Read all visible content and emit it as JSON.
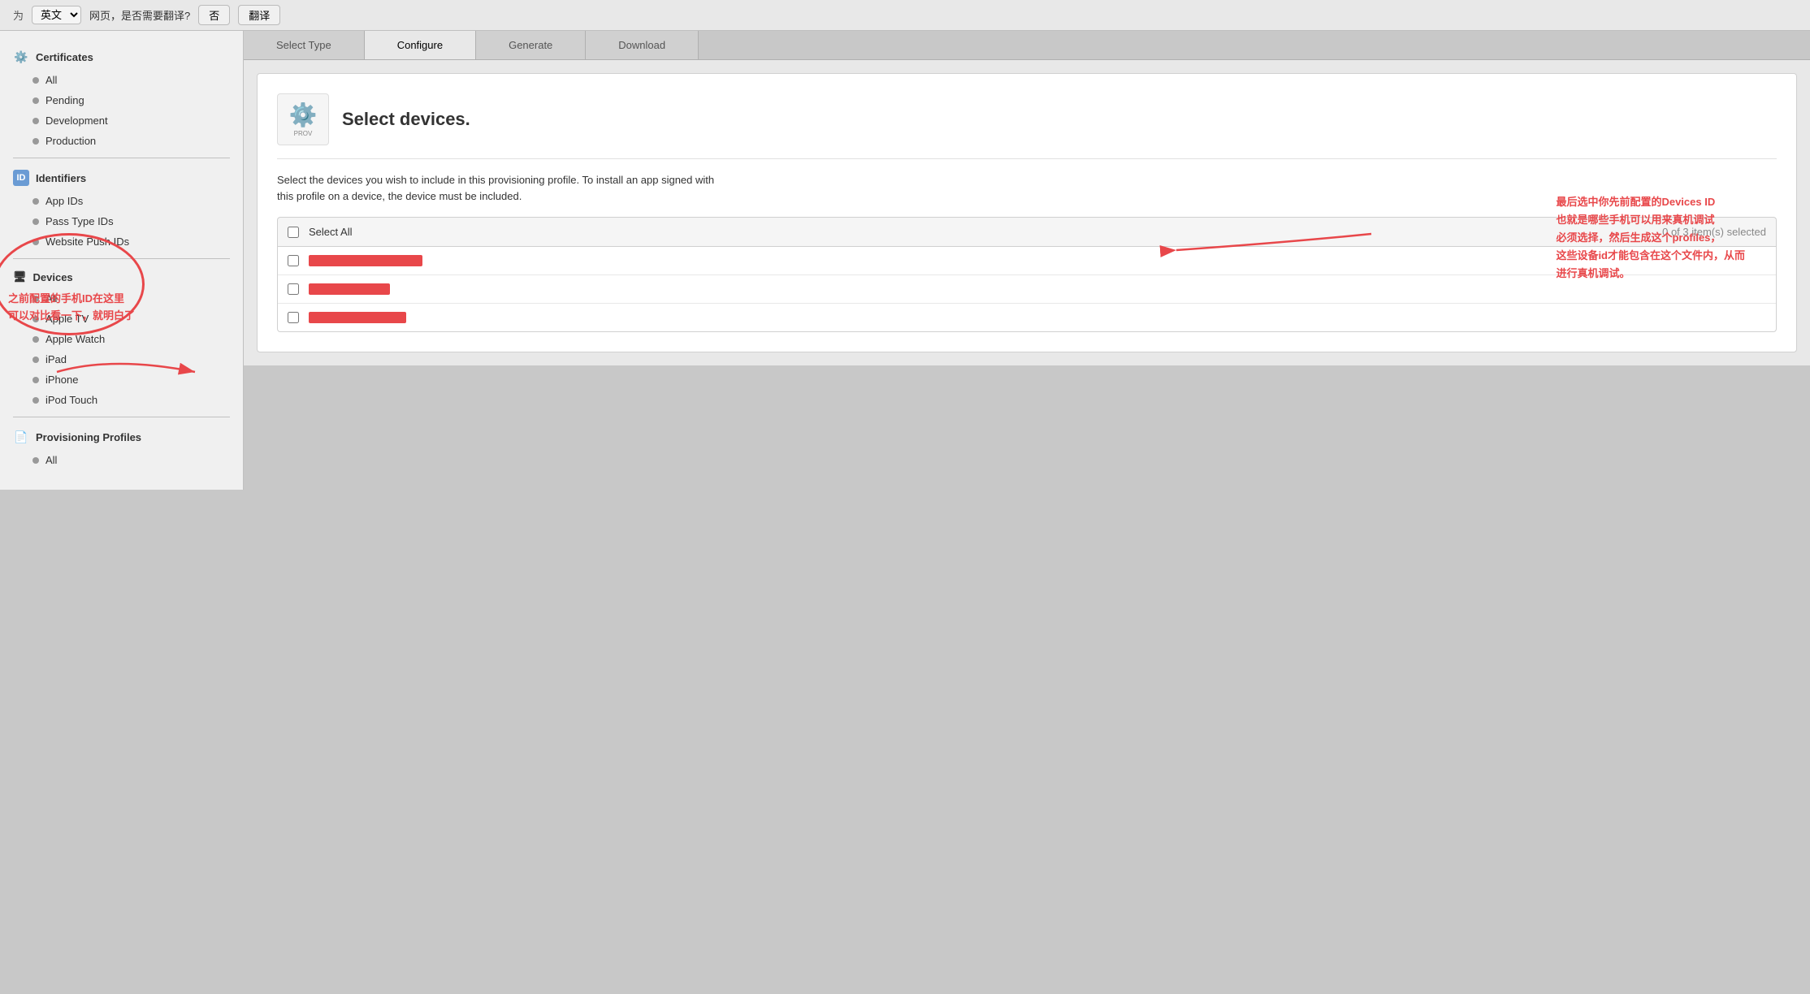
{
  "browser": {
    "lang_label": "为",
    "lang_value": "英文",
    "translate_prompt": "网页，是否需要翻译?",
    "no_button": "否",
    "translate_button": "翻译"
  },
  "steps": {
    "items": [
      {
        "label": "Select Type",
        "active": false
      },
      {
        "label": "Configure",
        "active": false
      },
      {
        "label": "Generate",
        "active": false
      },
      {
        "label": "Download",
        "active": false
      }
    ],
    "current": 2
  },
  "sidebar": {
    "certificates": {
      "header": "Certificates",
      "items": [
        "All",
        "Pending",
        "Development",
        "Production"
      ]
    },
    "identifiers": {
      "header": "Identifiers",
      "items": [
        "App IDs",
        "Pass Type IDs",
        "Website Push IDs"
      ]
    },
    "devices": {
      "header": "Devices",
      "items": [
        "All",
        "Apple TV",
        "Apple Watch",
        "iPad",
        "iPhone",
        "iPod Touch"
      ]
    },
    "provisioning": {
      "header": "Provisioning Profiles",
      "items": [
        "All"
      ]
    }
  },
  "content": {
    "title": "Select devices.",
    "description_line1": "Select the devices you wish to include in this provisioning profile. To install an app signed with",
    "description_line2": "this profile on a device, the device must be included.",
    "select_all_label": "Select All",
    "items_count": "0  of 3 item(s) selected"
  },
  "annotations": {
    "left_text_lines": [
      "之前配置的手机ID在这里",
      "可以对比看一下，就明白了"
    ],
    "right_text_lines": [
      "最后选中你先前配置的Devices ID",
      "也就是哪些手机可以用来真机调试",
      "必须选择，然后生成这个profiles，",
      "这些设备id才能包含在这个文件内，从而",
      "进行真机调试。"
    ]
  }
}
